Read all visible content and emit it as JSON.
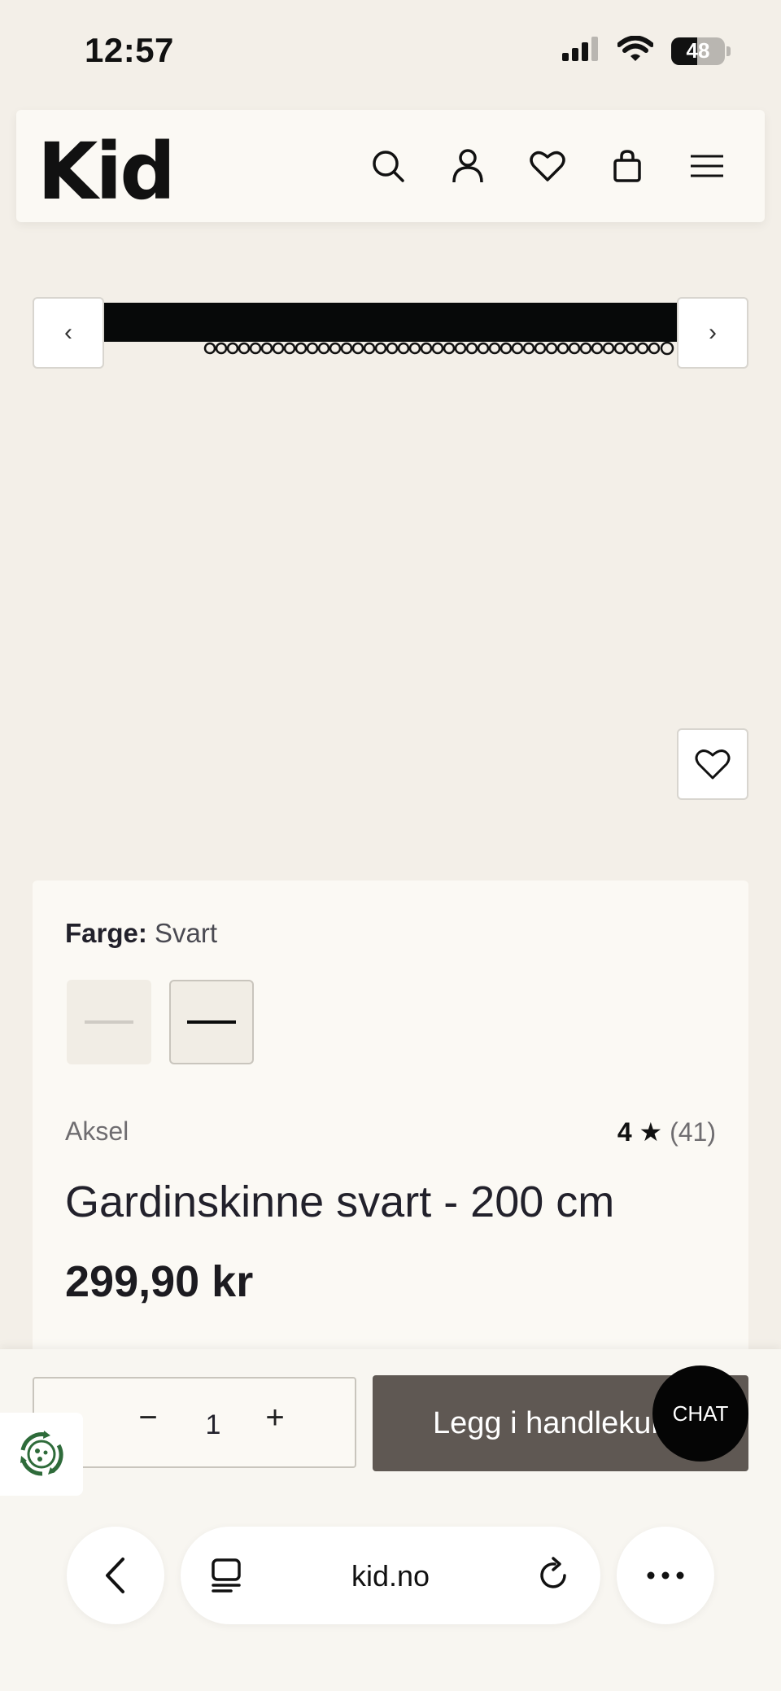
{
  "status_bar": {
    "time": "12:57",
    "battery_level": "48",
    "battery_fraction": 0.48
  },
  "header": {
    "logo": "Kid",
    "icons": [
      "search-icon",
      "user-icon",
      "heart-icon",
      "bag-icon",
      "menu-icon"
    ]
  },
  "gallery": {
    "prev_label": "‹",
    "next_label": "›"
  },
  "product": {
    "color_label": "Farge:",
    "color_value": "Svart",
    "swatches": [
      {
        "name": "white",
        "color": "#cfcbc4"
      },
      {
        "name": "black",
        "color": "#0b0b0b"
      }
    ],
    "brand": "Aksel",
    "rating_value": "4",
    "rating_star": "★",
    "rating_count": "(41)",
    "title": "Gardinskinne svart - 200 cm",
    "price": "299,90 kr"
  },
  "cart_bar": {
    "qty_minus": "−",
    "qty_value": "1",
    "qty_plus": "+",
    "add_to_cart": "Legg i handlekurv",
    "chat": "CHAT"
  },
  "browser": {
    "url": "kid.no"
  },
  "colors": {
    "background": "#f3efe8",
    "card": "#fbf9f4",
    "button": "#5f5853",
    "eco_green": "#2e6b3a"
  }
}
